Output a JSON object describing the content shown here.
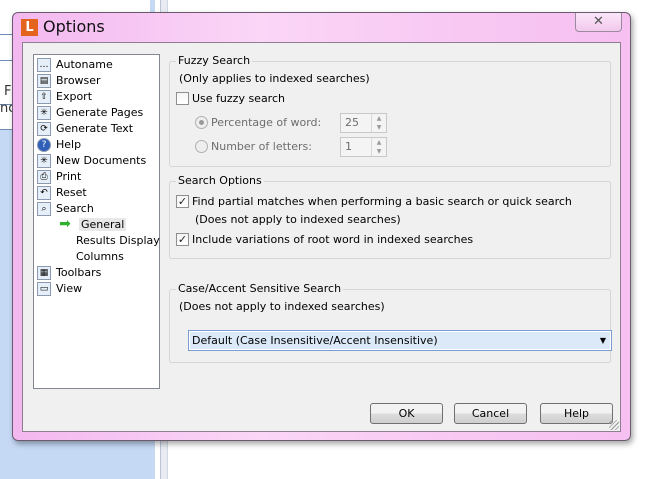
{
  "background": {
    "fragments": [
      "F",
      "nc"
    ]
  },
  "dialog": {
    "title": "Options",
    "app_icon_letter": "L",
    "close_glyph": "✕",
    "tree": [
      {
        "label": "Autoname",
        "icon": "autoname-icon",
        "glyph": "…"
      },
      {
        "label": "Browser",
        "icon": "browser-icon",
        "glyph": "▤"
      },
      {
        "label": "Export",
        "icon": "export-icon",
        "glyph": "⇧"
      },
      {
        "label": "Generate Pages",
        "icon": "generate-pages-icon",
        "glyph": "✳"
      },
      {
        "label": "Generate Text",
        "icon": "generate-text-icon",
        "glyph": "⟳"
      },
      {
        "label": "Help",
        "icon": "help-icon",
        "glyph": "?"
      },
      {
        "label": "New Documents",
        "icon": "new-documents-icon",
        "glyph": "✳"
      },
      {
        "label": "Print",
        "icon": "print-icon",
        "glyph": "⎙"
      },
      {
        "label": "Reset",
        "icon": "reset-icon",
        "glyph": "↶"
      },
      {
        "label": "Search",
        "icon": "search-icon",
        "glyph": "⌕"
      },
      {
        "label": "General",
        "icon": "green-arrow-icon",
        "glyph": "➡"
      },
      {
        "label": "Results Display"
      },
      {
        "label": "Columns"
      },
      {
        "label": "Toolbars",
        "icon": "toolbars-icon",
        "glyph": "▦"
      },
      {
        "label": "View",
        "icon": "view-icon",
        "glyph": "▭"
      }
    ],
    "fuzzy": {
      "title": "Fuzzy Search",
      "note": "(Only applies to indexed searches)",
      "use_label": "Use fuzzy search",
      "use_checked": false,
      "pct_label": "Percentage of word:",
      "pct_value": "25",
      "pct_selected": true,
      "letters_label": "Number of letters:",
      "letters_value": "1",
      "letters_selected": false
    },
    "options": {
      "title": "Search Options",
      "partial_label": "Find partial matches when performing a basic search or quick search",
      "partial_checked": true,
      "partial_note": "(Does not apply to indexed searches)",
      "variations_label": "Include variations of root word in indexed searches",
      "variations_checked": true
    },
    "case": {
      "title": "Case/Accent Sensitive Search",
      "note": "(Does not apply to indexed searches)",
      "selected": "Default (Case Insensitive/Accent Insensitive)"
    },
    "buttons": {
      "ok": "OK",
      "cancel": "Cancel",
      "help": "Help"
    },
    "check_glyph": "✓",
    "spin_glyphs": {
      "up": "▲",
      "down": "▼"
    },
    "dropdown_glyph": "▼"
  }
}
